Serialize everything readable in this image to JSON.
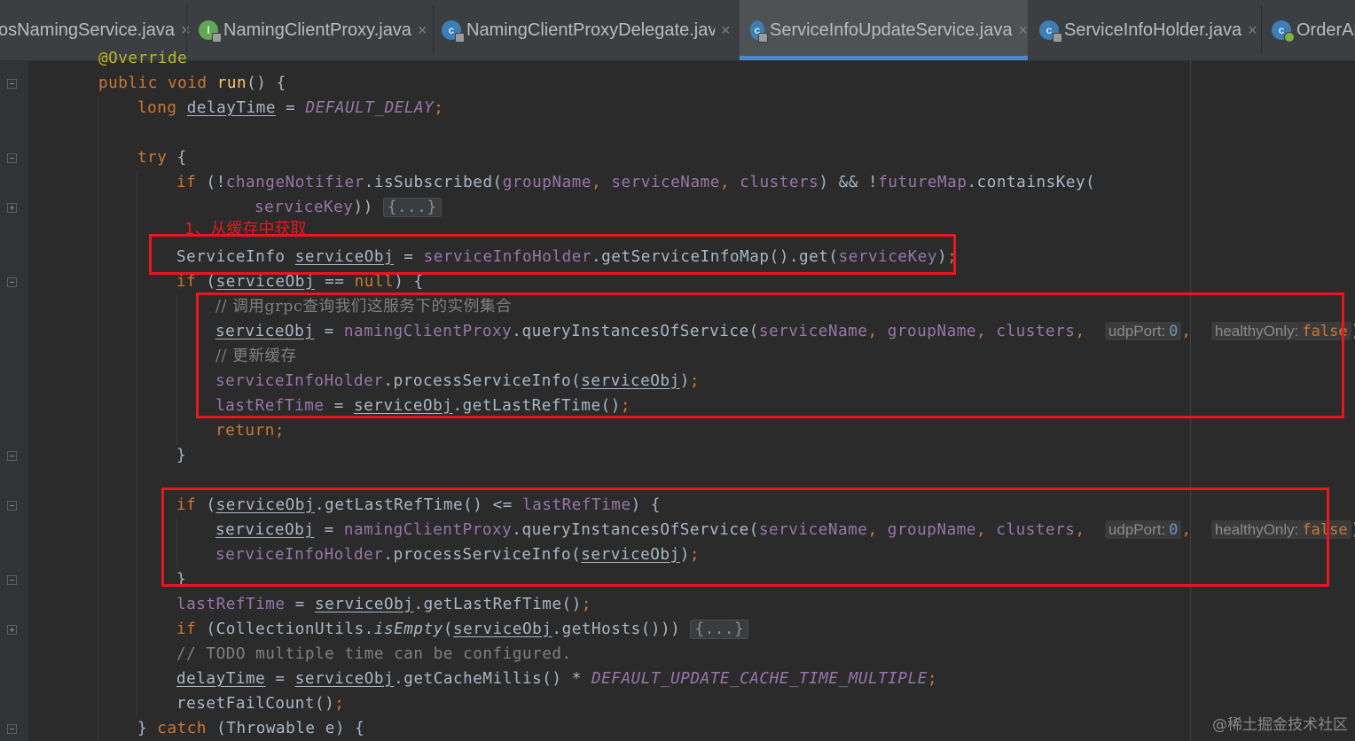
{
  "tabs": [
    {
      "label": "osNamingService.java",
      "icon": "none",
      "active": false
    },
    {
      "label": "NamingClientProxy.java",
      "icon": "interface-icon",
      "active": false
    },
    {
      "label": "NamingClientProxyDelegate.java",
      "icon": "class-icon",
      "active": false
    },
    {
      "label": "ServiceInfoUpdateService.java",
      "icon": "class-icon",
      "active": true
    },
    {
      "label": "ServiceInfoHolder.java",
      "icon": "class-icon",
      "active": false
    },
    {
      "label": "OrderAp",
      "icon": "class-icon",
      "active": false
    }
  ],
  "close_glyph": "×",
  "editor": {
    "annotation_partial": "@Override",
    "fold_collapsed": "{...}",
    "hints": {
      "udpPort_label": "udpPort:",
      "udpPort_value": "0",
      "healthyOnly_label": "healthyOnly:",
      "healthyOnly_value": "false"
    },
    "comments": {
      "grpc": "// 调用grpc查询我们这服务下的实例集合",
      "update_cache": "// 更新缓存",
      "todo": "// TODO multiple time can be configured."
    }
  },
  "annotations": {
    "label_1": "1、从缓存中获取",
    "color": "#e8161e"
  },
  "watermark": "@稀土掘金技术社区",
  "colors": {
    "background": "#2b2b2b",
    "keyword": "#cc7832",
    "method": "#ffc66d",
    "field": "#9876aa",
    "number": "#6897bb",
    "comment": "#808080",
    "tab_active_underline": "#4a88c7"
  }
}
